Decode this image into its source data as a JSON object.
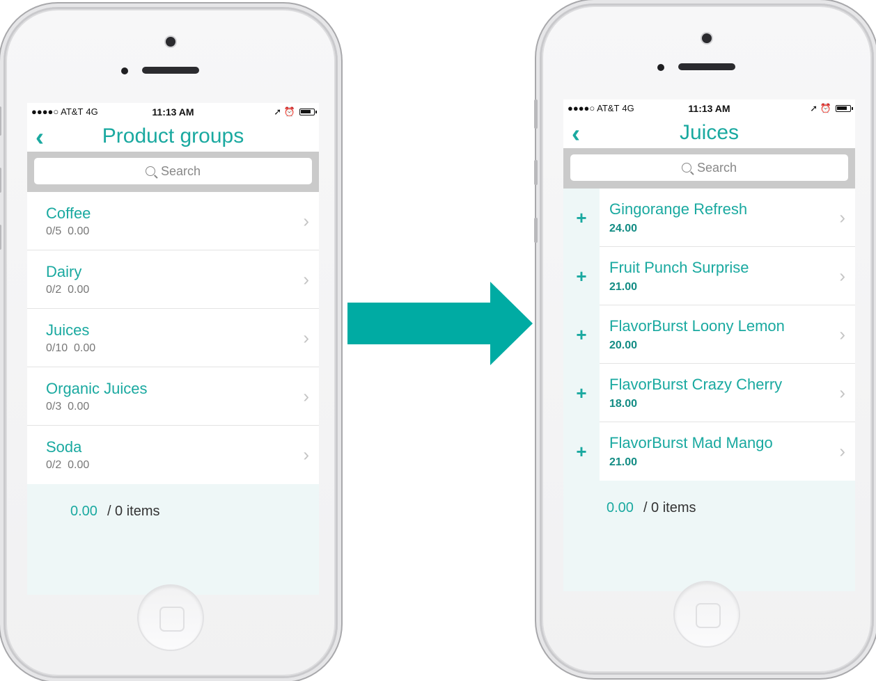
{
  "status_bar": {
    "carrier": "●●●●○ AT&T",
    "network": "4G",
    "time": "11:13 AM",
    "right_icons": "➚ ⏰"
  },
  "left_screen": {
    "title": "Product groups",
    "search_placeholder": "Search",
    "groups": [
      {
        "name": "Coffee",
        "count": "0/5",
        "amount": "0.00"
      },
      {
        "name": "Dairy",
        "count": "0/2",
        "amount": "0.00"
      },
      {
        "name": "Juices",
        "count": "0/10",
        "amount": "0.00"
      },
      {
        "name": "Organic Juices",
        "count": "0/3",
        "amount": "0.00"
      },
      {
        "name": "Soda",
        "count": "0/2",
        "amount": "0.00"
      }
    ],
    "footer_total": "0.00",
    "footer_items": "/ 0 items"
  },
  "right_screen": {
    "title": "Juices",
    "search_placeholder": "Search",
    "products": [
      {
        "name": "Gingorange Refresh",
        "price": "24.00"
      },
      {
        "name": "Fruit Punch Surprise",
        "price": "21.00"
      },
      {
        "name": "FlavorBurst Loony Lemon",
        "price": "20.00"
      },
      {
        "name": "FlavorBurst Crazy Cherry",
        "price": "18.00"
      },
      {
        "name": "FlavorBurst Mad Mango",
        "price": "21.00"
      }
    ],
    "footer_total": "0.00",
    "footer_items": "/ 0 items"
  },
  "icons": {
    "back": "chevron-left-icon",
    "row": "chevron-right-icon",
    "add": "plus-icon",
    "search": "search-icon",
    "transition": "arrow-right-icon"
  },
  "colors": {
    "accent": "#1aa9a0",
    "footer_bg": "#eef7f7",
    "search_bar_bg": "#cacaca",
    "arrow": "#00aba3"
  }
}
